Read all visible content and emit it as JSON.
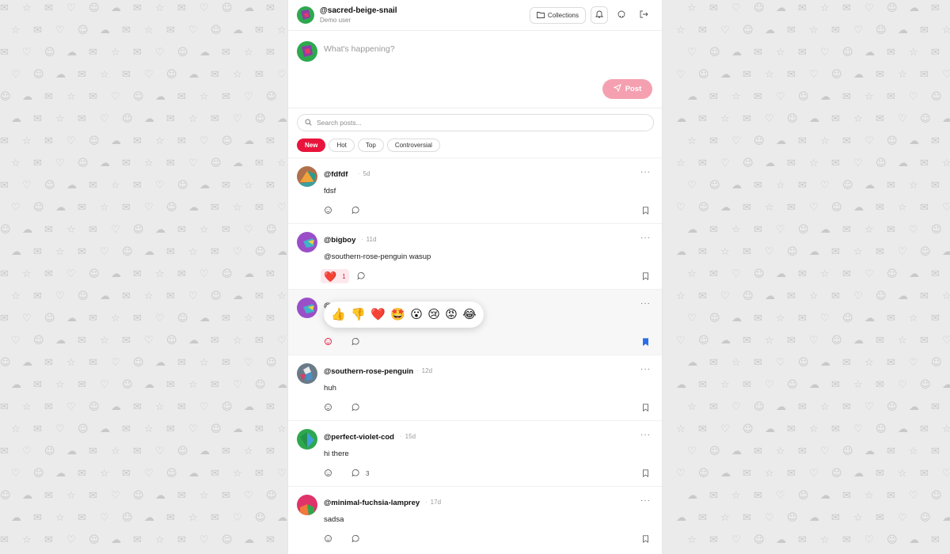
{
  "header": {
    "username": "@sacred-beige-snail",
    "subtitle": "Demo user",
    "collections_label": "Collections",
    "bell_icon": "bell-icon",
    "github_icon": "github-icon",
    "logout_icon": "logout-icon"
  },
  "composer": {
    "placeholder": "What's happening?",
    "post_label": "Post"
  },
  "search": {
    "placeholder": "Search posts..."
  },
  "filters": [
    "New",
    "Hot",
    "Top",
    "Controversial"
  ],
  "active_filter": "New",
  "posts": [
    {
      "author": "@fdfdf",
      "time": "5d",
      "body": "fdsf",
      "reaction_count": "",
      "comment_count": "",
      "bookmarked": false
    },
    {
      "author": "@bigboy",
      "time": "11d",
      "body": "@southern-rose-penguin wasup",
      "reaction_emoji": "❤️",
      "reaction_count": "1",
      "comment_count": "",
      "bookmarked": false
    },
    {
      "author": "@",
      "time": "",
      "body": "",
      "reaction_count": "",
      "comment_count": "",
      "bookmarked": true
    },
    {
      "author": "@southern-rose-penguin",
      "time": "12d",
      "body": "huh",
      "reaction_count": "",
      "comment_count": "",
      "bookmarked": false
    },
    {
      "author": "@perfect-violet-cod",
      "time": "15d",
      "body": "hi there",
      "reaction_count": "",
      "comment_count": "3",
      "bookmarked": false
    },
    {
      "author": "@minimal-fuchsia-lamprey",
      "time": "17d",
      "body": "sadsa",
      "reaction_count": "",
      "comment_count": "",
      "bookmarked": false
    }
  ],
  "reaction_picker": [
    "👍",
    "👎",
    "❤️",
    "🤩",
    "😮",
    "😢",
    "😡",
    "😂"
  ],
  "colors": {
    "accent": "#e8143c",
    "post_button_disabled": "#f5a0b0",
    "bookmark_active": "#2b6de8",
    "page_bg": "#ebebeb"
  }
}
